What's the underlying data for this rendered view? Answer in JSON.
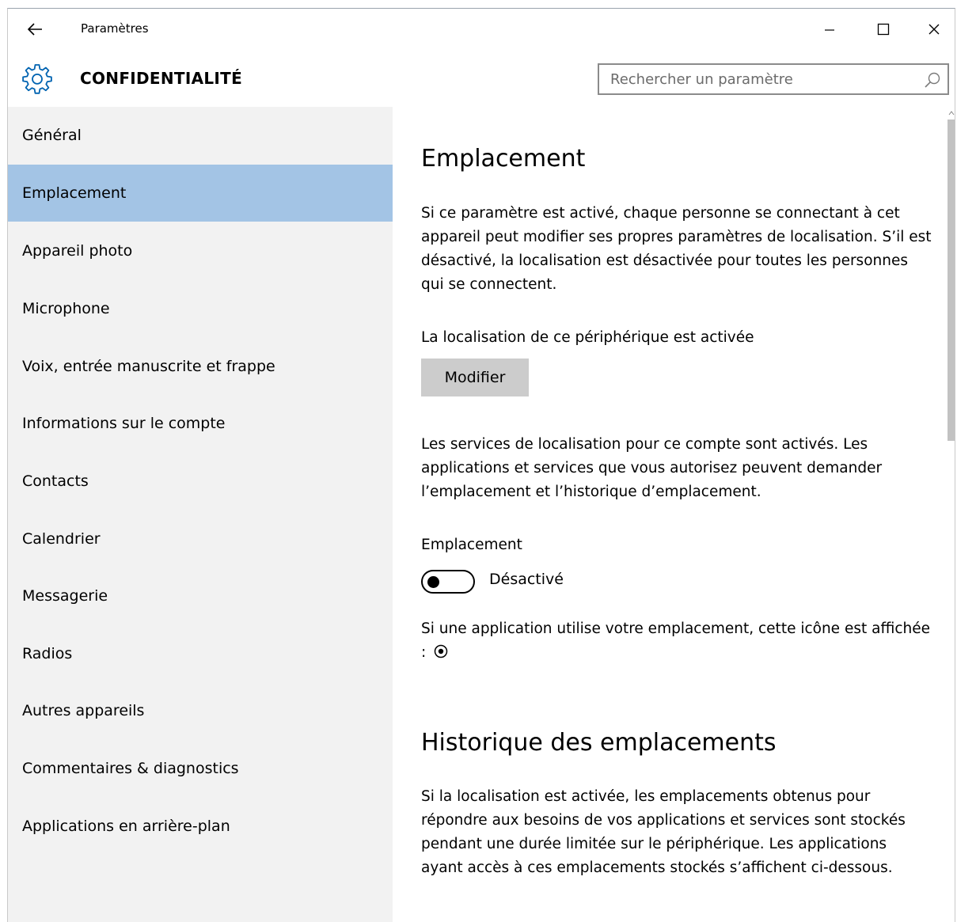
{
  "window": {
    "app_title": "Paramètres",
    "back_icon": "back-arrow-icon",
    "minimize_icon": "minimize-icon",
    "maximize_icon": "maximize-icon",
    "close_icon": "close-icon"
  },
  "header": {
    "icon": "gear-icon",
    "title": "CONFIDENTIALITÉ",
    "search_placeholder": "Rechercher un paramètre",
    "search_icon": "search-icon"
  },
  "colors": {
    "sidebar_bg": "#f2f2f2",
    "selected_bg": "#a3c4e5",
    "accent": "#0063b1",
    "button_bg": "#cccccc"
  },
  "sidebar": {
    "selected_index": 1,
    "items": [
      {
        "label": "Général"
      },
      {
        "label": "Emplacement"
      },
      {
        "label": "Appareil photo"
      },
      {
        "label": "Microphone"
      },
      {
        "label": "Voix, entrée manuscrite et frappe"
      },
      {
        "label": "Informations sur le compte"
      },
      {
        "label": "Contacts"
      },
      {
        "label": "Calendrier"
      },
      {
        "label": "Messagerie"
      },
      {
        "label": "Radios"
      },
      {
        "label": "Autres appareils"
      },
      {
        "label": "Commentaires & diagnostics"
      },
      {
        "label": "Applications en arrière-plan"
      }
    ]
  },
  "content": {
    "section1_title": "Emplacement",
    "section1_desc": "Si ce paramètre est activé, chaque personne se connectant à cet appareil peut modifier ses propres paramètres de localisation. S’il est désactivé, la localisation est désactivée pour toutes les personnes qui se connectent.",
    "device_status": "La localisation de ce périphérique est activée",
    "modify_button": "Modifier",
    "account_desc": "Les services de localisation pour ce compte sont activés. Les applications et services que vous autorisez peuvent demander l’emplacement et l’historique d’emplacement.",
    "toggle_title": "Emplacement",
    "toggle_state": "Désactivé",
    "toggle_on": false,
    "icon_note": "Si une application utilise votre emplacement, cette icône est affichée :",
    "icon_note_icon": "location-indicator-icon",
    "section2_title": "Historique des emplacements",
    "section2_desc": "Si la localisation est activée, les emplacements obtenus pour répondre aux besoins de vos applications et services sont stockés pendant une durée limitée sur le périphérique. Les applications ayant accès à ces emplacements stockés s’affichent ci-dessous."
  }
}
